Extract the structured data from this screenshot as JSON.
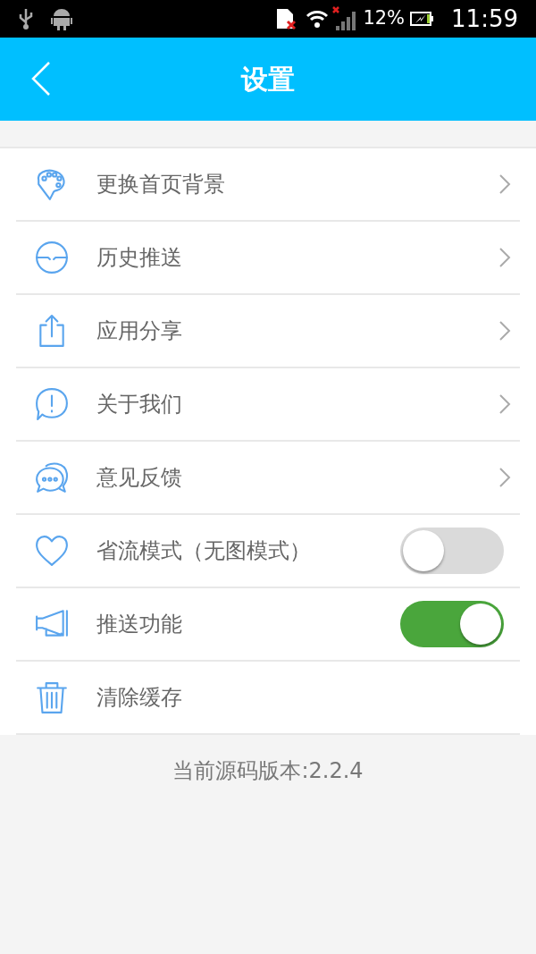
{
  "status_bar": {
    "battery": "12%",
    "time": "11:59"
  },
  "header": {
    "title": "设置"
  },
  "items": [
    {
      "label": "更换首页背景",
      "kind": "link"
    },
    {
      "label": "历史推送",
      "kind": "link"
    },
    {
      "label": "应用分享",
      "kind": "link"
    },
    {
      "label": "关于我们",
      "kind": "link"
    },
    {
      "label": "意见反馈",
      "kind": "link"
    },
    {
      "label": "省流模式（无图模式）",
      "kind": "toggle",
      "on": false
    },
    {
      "label": "推送功能",
      "kind": "toggle",
      "on": true
    },
    {
      "label": "清除缓存",
      "kind": "plain"
    }
  ],
  "footer": {
    "version": "当前源码版本:2.2.4"
  }
}
